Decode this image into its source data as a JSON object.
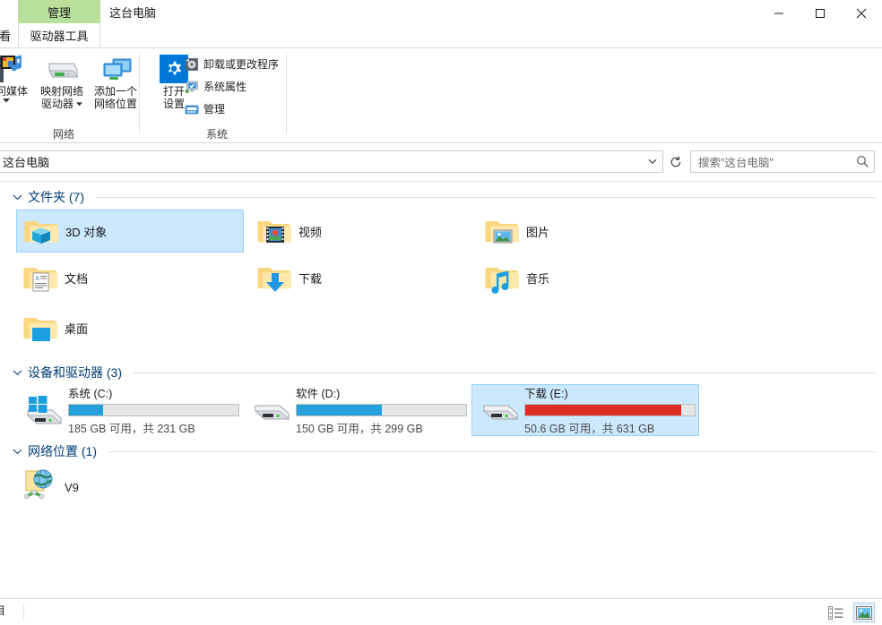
{
  "window": {
    "title": "这台电脑",
    "tabs": [
      {
        "label": "管理",
        "kind": "contextual-parent"
      },
      {
        "label": "驱动器工具",
        "kind": "contextual-child"
      },
      {
        "label": "看",
        "kind": "partial"
      }
    ],
    "controls": {
      "minimize": "minimize-icon",
      "maximize": "maximize-icon",
      "close": "close-icon",
      "collapse_ribbon": "chevron-up-icon",
      "help": "?"
    }
  },
  "ribbon": {
    "groups": [
      {
        "name": "网络",
        "big_buttons": [
          {
            "label": "访问媒体",
            "icon": "media-server-icon",
            "has_dropdown": true
          },
          {
            "label": "映射网络\n驱动器",
            "label_line1": "映射网络",
            "label_line2": "驱动器",
            "icon": "map-network-drive-icon",
            "has_dropdown": true
          },
          {
            "label": "添加一个\n网络位置",
            "label_line1": "添加一个",
            "label_line2": "网络位置",
            "icon": "add-network-location-icon",
            "has_dropdown": false
          }
        ],
        "small_buttons": []
      },
      {
        "name": "系统",
        "big_buttons": [
          {
            "label_line1": "打开",
            "label_line2": "设置",
            "icon": "settings-gear-icon",
            "has_dropdown": false
          }
        ],
        "small_buttons": [
          {
            "label": "卸载或更改程序",
            "icon": "uninstall-program-icon"
          },
          {
            "label": "系统属性",
            "icon": "system-properties-icon"
          },
          {
            "label": "管理",
            "icon": "computer-management-icon"
          }
        ]
      }
    ]
  },
  "addressbar": {
    "path": "这台电脑",
    "dropdown_icon": "chevron-down-icon",
    "refresh_icon": "refresh-icon"
  },
  "search": {
    "placeholder": "搜索\"这台电脑\"",
    "icon": "search-icon"
  },
  "sections": [
    {
      "id": "folders",
      "title": "文件夹 (7)",
      "chevron": "chevron-down-icon",
      "items": [
        {
          "label": "3D 对象",
          "icon": "folder-3d-objects-icon",
          "selected": true
        },
        {
          "label": "视频",
          "icon": "folder-videos-icon",
          "selected": false
        },
        {
          "label": "图片",
          "icon": "folder-pictures-icon",
          "selected": false
        },
        {
          "label": "文档",
          "icon": "folder-documents-icon",
          "selected": false
        },
        {
          "label": "下载",
          "icon": "folder-downloads-icon",
          "selected": false
        },
        {
          "label": "音乐",
          "icon": "folder-music-icon",
          "selected": false
        },
        {
          "label": "桌面",
          "icon": "folder-desktop-icon",
          "selected": false
        }
      ]
    },
    {
      "id": "drives",
      "title": "设备和驱动器 (3)",
      "chevron": "chevron-down-icon",
      "items": [
        {
          "label": "系统 (C:)",
          "icon": "windows-drive-icon",
          "free_text": "185 GB 可用，共 231 GB",
          "free_gb": 185,
          "total_gb": 231,
          "used_percent": 20,
          "bar_color": "#26a0da",
          "selected": false
        },
        {
          "label": "软件 (D:)",
          "icon": "hard-drive-icon",
          "free_text": "150 GB 可用，共 299 GB",
          "free_gb": 150,
          "total_gb": 299,
          "used_percent": 50,
          "bar_color": "#26a0da",
          "selected": false
        },
        {
          "label": "下载 (E:)",
          "icon": "hard-drive-icon",
          "free_text": "50.6 GB 可用，共 631 GB",
          "free_gb": 50.6,
          "total_gb": 631,
          "used_percent": 92,
          "bar_color": "#dd2c24",
          "selected": true
        }
      ]
    },
    {
      "id": "network",
      "title": "网络位置 (1)",
      "chevron": "chevron-down-icon",
      "items": [
        {
          "label": "V9",
          "icon": "network-location-icon",
          "selected": false
        }
      ]
    }
  ],
  "statusbar": {
    "item_count_partial": "目",
    "views": [
      {
        "name": "details-view-button",
        "icon": "details-view-icon",
        "active": false
      },
      {
        "name": "large-icons-view-button",
        "icon": "large-icons-view-icon",
        "active": true
      }
    ]
  },
  "colors": {
    "tab_contextual": "#b9e09a",
    "selection_fill": "#cce8ff",
    "selection_border": "#99d1ff",
    "group_header_text": "#003c74",
    "accent_blue": "#26a0da",
    "warning_red": "#dd2c24",
    "settings_tile": "#0078d7"
  }
}
